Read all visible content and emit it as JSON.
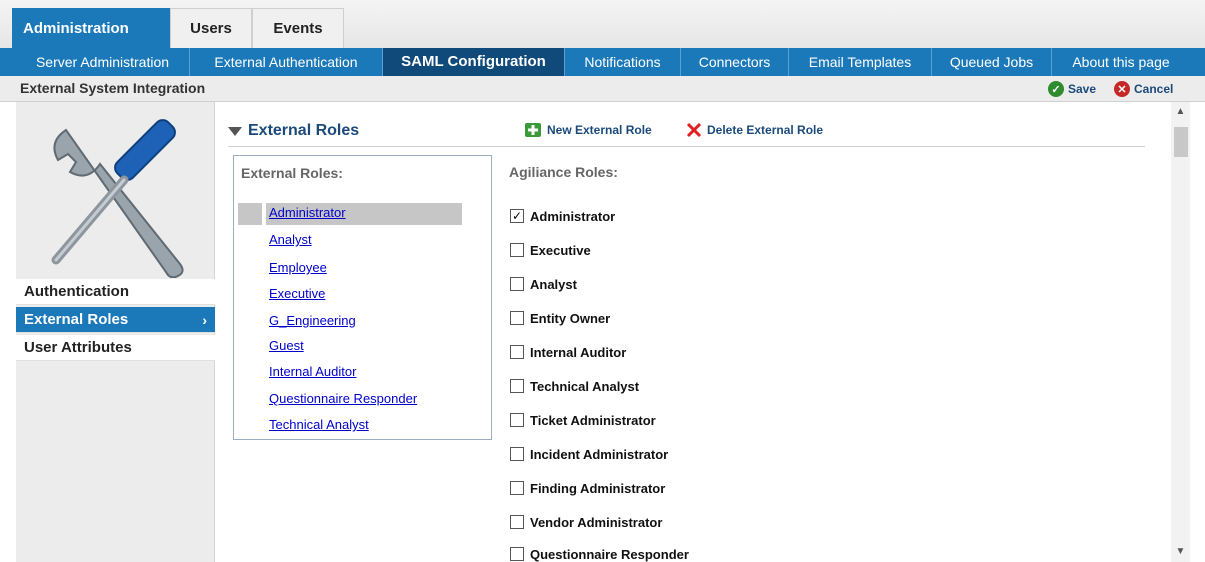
{
  "top_tabs": [
    {
      "label": "Administration"
    },
    {
      "label": "Users"
    },
    {
      "label": "Events"
    }
  ],
  "sub_nav": [
    {
      "label": "Server Administration"
    },
    {
      "label": "External Authentication"
    },
    {
      "label": "SAML Configuration"
    },
    {
      "label": "Notifications"
    },
    {
      "label": "Connectors"
    },
    {
      "label": "Email Templates"
    },
    {
      "label": "Queued Jobs"
    },
    {
      "label": "About this page"
    }
  ],
  "page_title": "External System Integration",
  "toolbar": {
    "save_label": "Save",
    "cancel_label": "Cancel"
  },
  "sidebar": {
    "items": [
      {
        "label": "Authentication"
      },
      {
        "label": "External Roles",
        "chevron": "›"
      },
      {
        "label": "User Attributes"
      }
    ]
  },
  "section": {
    "title": "External Roles",
    "new_label": "New External Role",
    "delete_label": "Delete External Role"
  },
  "external_roles": {
    "title": "External Roles:",
    "items": [
      {
        "label": "Administrator"
      },
      {
        "label": "Analyst"
      },
      {
        "label": "Employee"
      },
      {
        "label": "Executive"
      },
      {
        "label": "G_Engineering"
      },
      {
        "label": "Guest"
      },
      {
        "label": "Internal Auditor"
      },
      {
        "label": "Questionnaire Responder"
      },
      {
        "label": "Technical Analyst"
      }
    ]
  },
  "agiliance_roles": {
    "title": "Agiliance Roles:",
    "items": [
      {
        "label": "Administrator",
        "checked": true
      },
      {
        "label": "Executive",
        "checked": false
      },
      {
        "label": "Analyst",
        "checked": false
      },
      {
        "label": "Entity Owner",
        "checked": false
      },
      {
        "label": "Internal Auditor",
        "checked": false
      },
      {
        "label": "Technical Analyst",
        "checked": false
      },
      {
        "label": "Ticket Administrator",
        "checked": false
      },
      {
        "label": "Incident Administrator",
        "checked": false
      },
      {
        "label": "Finding Administrator",
        "checked": false
      },
      {
        "label": "Vendor Administrator",
        "checked": false
      },
      {
        "label": "Questionnaire Responder",
        "checked": false
      }
    ]
  },
  "colors": {
    "accent": "#1b79b9",
    "active_sub": "#0f4a7a",
    "link": "#0000cc"
  }
}
